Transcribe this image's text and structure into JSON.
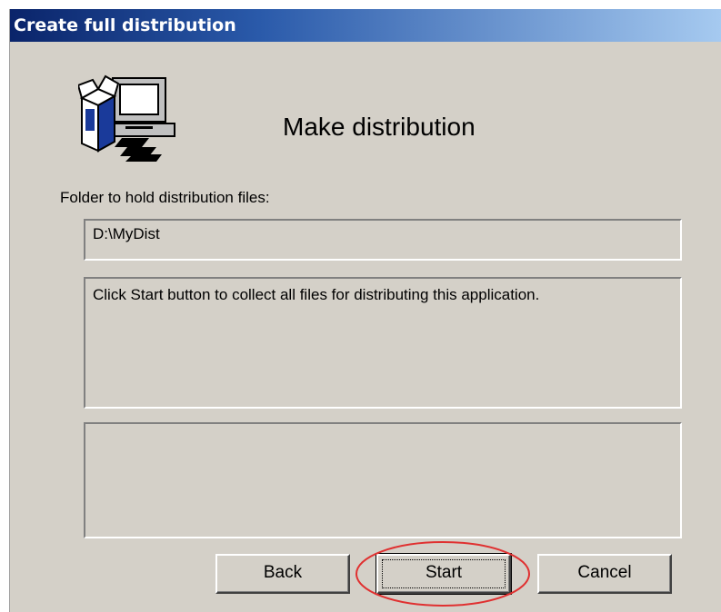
{
  "window": {
    "title": "Create full distribution"
  },
  "header": {
    "icon": "computer-distribution-icon",
    "heading": "Make distribution"
  },
  "folder": {
    "label": "Folder to hold distribution files:",
    "path": "D:\\MyDist"
  },
  "message": {
    "text": "Click Start button to collect all files for distributing this application."
  },
  "log": {
    "text": ""
  },
  "buttons": {
    "back": "Back",
    "start": "Start",
    "cancel": "Cancel"
  },
  "annotation": {
    "highlight_color": "#e03030",
    "highlighted_button": "Start"
  },
  "colors": {
    "dialog_bg": "#d4d0c8",
    "titlebar_start": "#0a246a",
    "titlebar_end": "#a6caf0"
  }
}
